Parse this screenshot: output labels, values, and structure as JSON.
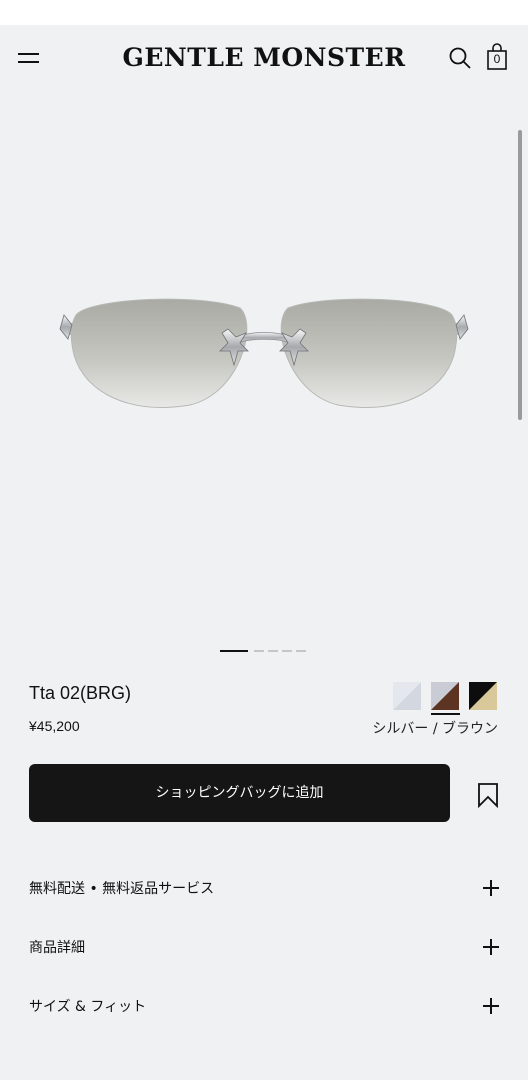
{
  "header": {
    "logo_text": "GENTLE MONSTER",
    "bag_count": "0"
  },
  "gallery": {
    "image": "silver-oval-rimless-sunglasses",
    "slide_count": 5,
    "active_slide": 1
  },
  "product": {
    "name": "Tta 02(BRG)",
    "price": "¥45,200",
    "color_label": "シルバー / ブラウン",
    "swatches": [
      {
        "name": "silver",
        "colors": [
          "#d7dbe3",
          "#f4f5f8"
        ]
      },
      {
        "name": "silver-brown",
        "colors": [
          "#5c3421",
          "#c9ccd4"
        ],
        "selected": true
      },
      {
        "name": "black-gold",
        "colors": [
          "#0d0d0d",
          "#d9c99a"
        ]
      }
    ]
  },
  "actions": {
    "add_to_bag_label": "ショッピングバッグに追加"
  },
  "accordion": [
    {
      "label": "無料配送 • 無料返品サービス"
    },
    {
      "label": "商品詳細"
    },
    {
      "label": "サイズ & フィット"
    }
  ],
  "colors": {
    "background": "#f0f1f3",
    "primary_button": "#151515"
  }
}
